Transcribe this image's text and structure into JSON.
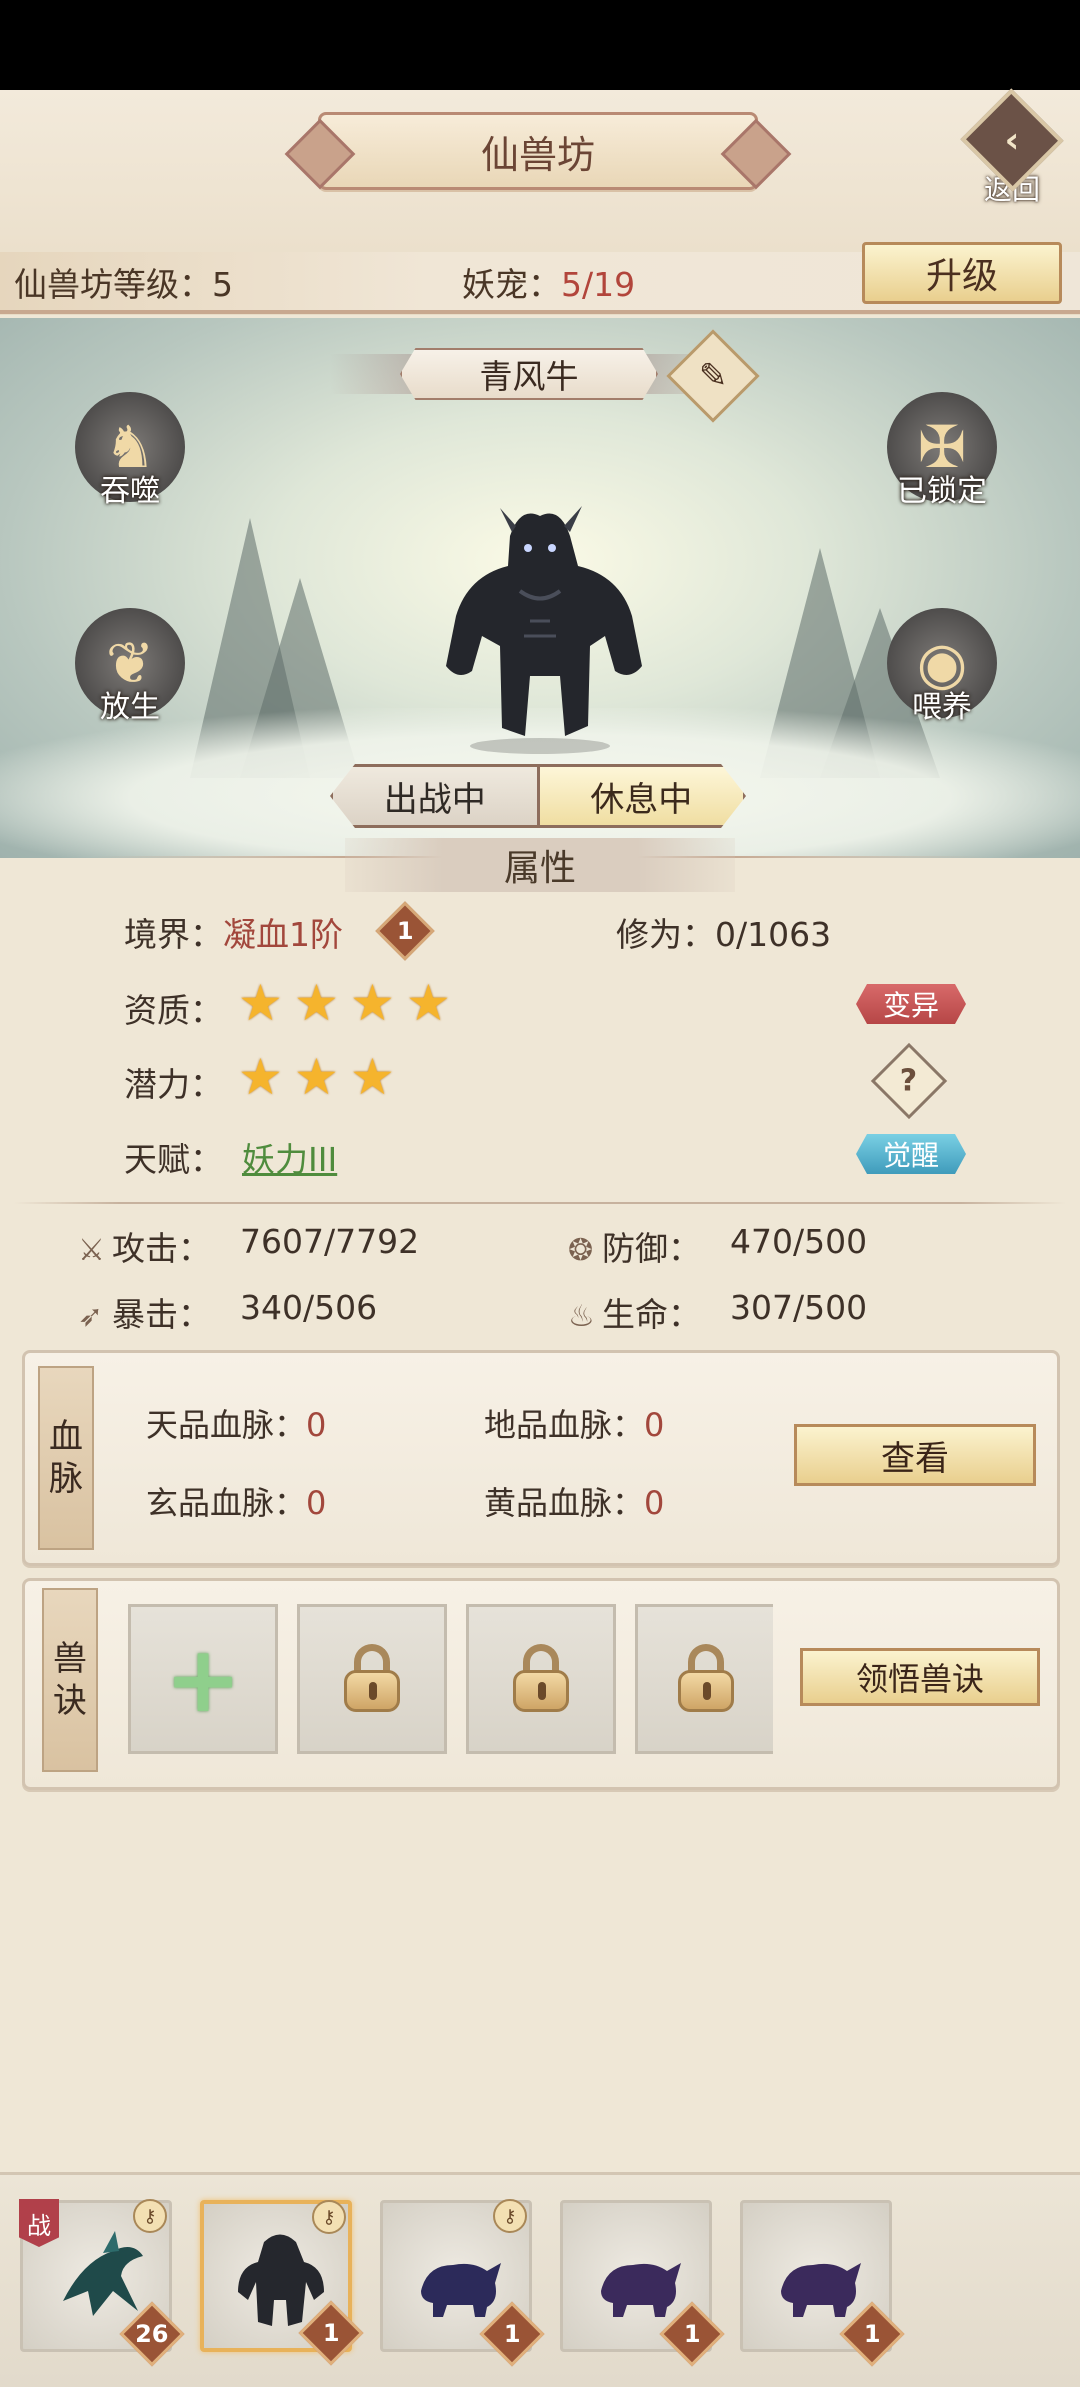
{
  "header": {
    "title": "仙兽坊",
    "back_label": "返回",
    "level_label": "仙兽坊等级：5",
    "pet_label": "妖宠：",
    "pet_value": "5/19",
    "upgrade_label": "升级"
  },
  "scene": {
    "pet_name": "青风牛",
    "devour_label": "吞噬",
    "locked_label": "已锁定",
    "release_label": "放生",
    "feed_label": "喂养",
    "battle_label": "出战中",
    "rest_label": "休息中"
  },
  "attributes": {
    "section_title": "属性",
    "realm_label": "境界：",
    "realm_value": "凝血1阶",
    "realm_badge": "1",
    "cultivation_label": "修为：0/1063",
    "quality_label": "资质：",
    "quality_stars": 4,
    "mutate_label": "变异",
    "potential_label": "潜力：",
    "potential_stars": 3,
    "talent_label": "天赋：",
    "talent_value": "妖力III",
    "awaken_label": "觉醒"
  },
  "stats": {
    "attack_label": "攻击：",
    "attack_value": "7607/7792",
    "defense_label": "防御：",
    "defense_value": "470/500",
    "crit_label": "暴击：",
    "crit_value": "340/506",
    "life_label": "生命：",
    "life_value": "307/500"
  },
  "bloodline": {
    "title_1": "血",
    "title_2": "脉",
    "tian_label": "天品血脉：",
    "tian_value": "0",
    "di_label": "地品血脉：",
    "di_value": "0",
    "xuan_label": "玄品血脉：",
    "xuan_value": "0",
    "huang_label": "黄品血脉：",
    "huang_value": "0",
    "view_label": "查看"
  },
  "skills": {
    "title_1": "兽",
    "title_2": "诀",
    "learn_label": "领悟兽诀"
  },
  "roster": {
    "war_tag": "战",
    "cards": [
      {
        "level": "26"
      },
      {
        "level": "1"
      },
      {
        "level": "1"
      },
      {
        "level": "1"
      },
      {
        "level": "1"
      }
    ]
  },
  "colors": {
    "accent_red": "#a2473c",
    "gold_button": "#e9cf8e",
    "talent_green": "#4f8c3d"
  }
}
